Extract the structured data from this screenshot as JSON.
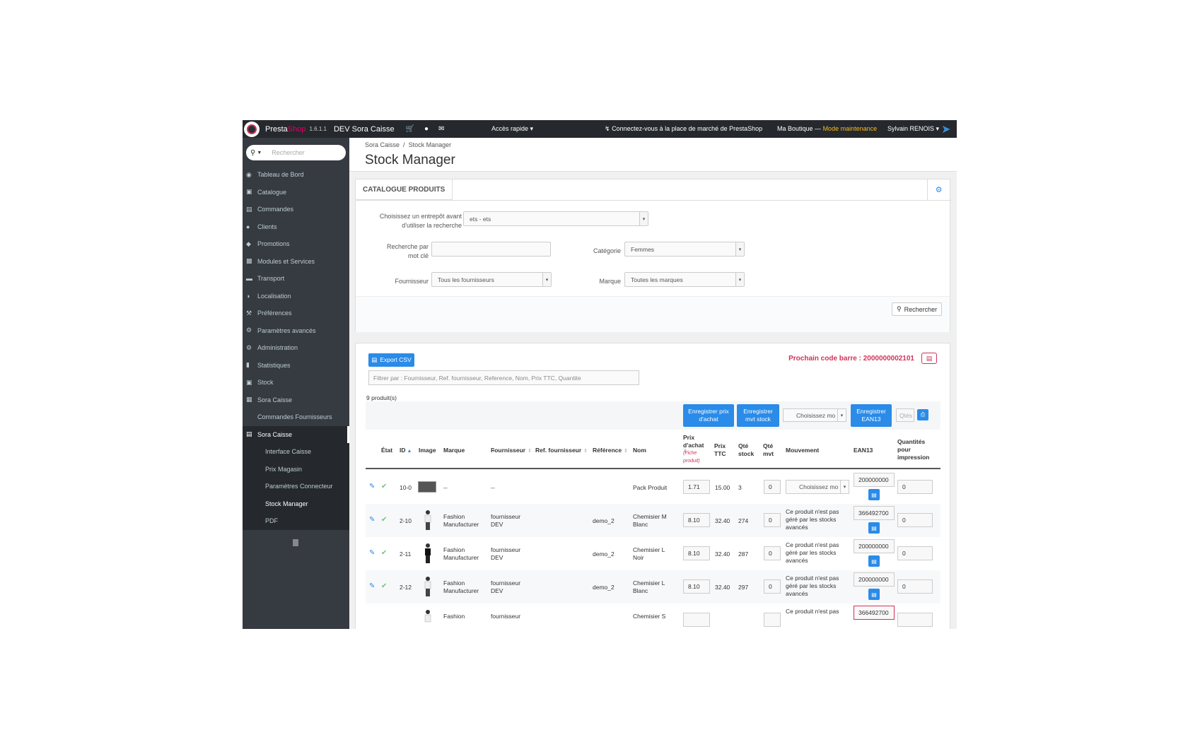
{
  "header": {
    "brand_presta": "Presta",
    "brand_shop": "Shop",
    "version": "1.6.1.1",
    "shop_name": "DEV Sora Caisse",
    "quick_access": "Accès rapide",
    "marketplace": "Connectez-vous à la place de marché de PrestaShop",
    "boutique": "Ma Boutique —",
    "maintenance": "Mode maintenance",
    "user": "Sylvain RENOIS"
  },
  "sidebar": {
    "search_placeholder": "Rechercher",
    "items": [
      {
        "label": "Tableau de Bord",
        "icon": "dashboard-icon"
      },
      {
        "label": "Catalogue",
        "icon": "book-icon"
      },
      {
        "label": "Commandes",
        "icon": "credit-card-icon"
      },
      {
        "label": "Clients",
        "icon": "users-icon"
      },
      {
        "label": "Promotions",
        "icon": "tag-icon"
      },
      {
        "label": "Modules et Services",
        "icon": "puzzle-icon"
      },
      {
        "label": "Transport",
        "icon": "truck-icon"
      },
      {
        "label": "Localisation",
        "icon": "globe-icon"
      },
      {
        "label": "Préférences",
        "icon": "wrench-icon"
      },
      {
        "label": "Paramètres avancés",
        "icon": "gears-icon"
      },
      {
        "label": "Administration",
        "icon": "cog-icon"
      },
      {
        "label": "Statistiques",
        "icon": "bar-chart-icon"
      },
      {
        "label": "Stock",
        "icon": "archive-icon"
      },
      {
        "label": "Sora Caisse",
        "icon": "grid-icon"
      },
      {
        "label": "Commandes Fournisseurs",
        "icon": ""
      },
      {
        "label": "Sora Caisse",
        "icon": "list-icon"
      }
    ],
    "sub_items": [
      "Interface Caisse",
      "Prix Magasin",
      "Paramètres Connecteur",
      "Stock Manager",
      "PDF"
    ]
  },
  "page": {
    "breadcrumb_parent": "Sora Caisse",
    "breadcrumb_sep": "/",
    "breadcrumb_current": "Stock Manager",
    "title": "Stock Manager"
  },
  "search_panel": {
    "tab": "CATALOGUE PRODUITS",
    "warehouse_label_1": "Choisissez un entrepôt avant",
    "warehouse_label_2": "d'utiliser la recherche",
    "warehouse_value": "ets - ets",
    "keyword_label_1": "Recherche par",
    "keyword_label_2": "mot clé",
    "keyword_value": "",
    "category_label": "Catégorie",
    "category_value": "Femmes",
    "supplier_label": "Fournisseur",
    "supplier_value": "Tous les fournisseurs",
    "brand_label": "Marque",
    "brand_value": "Toutes les marques",
    "search_button": "Rechercher"
  },
  "products_panel": {
    "export_csv": "Export CSV",
    "next_barcode": "Prochain code barre : 2000000002101",
    "filter_placeholder": "Filtrer par : Fournisseur, Ref. fournisseur, Reference, Nom, Prix TTC, Quantite",
    "count": "9 produit(s)",
    "btn_save_price_1": "Enregistrer prix",
    "btn_save_price_2": "d'achat",
    "btn_save_mvt_1": "Enregistrer",
    "btn_save_mvt_2": "mvt stock",
    "movement_select": "Choisissez mo",
    "btn_save_ean_1": "Enregistrer",
    "btn_save_ean_2": "EAN13",
    "qty_placeholder": "Qtés"
  },
  "table": {
    "headers": {
      "etat": "État",
      "id": "ID",
      "image": "Image",
      "marque": "Marque",
      "fournisseur": "Fournisseur",
      "ref_fournisseur": "Ref. fournisseur",
      "reference": "Référence",
      "nom": "Nom",
      "prix_achat_1": "Prix",
      "prix_achat_2": "d'achat",
      "fiche_1": "(Fiche",
      "fiche_2": "produit)",
      "prix_ttc_1": "Prix",
      "prix_ttc_2": "TTC",
      "qte_stock_1": "Qté",
      "qte_stock_2": "stock",
      "qte_mvt_1": "Qté",
      "qte_mvt_2": "mvt",
      "mouvement": "Mouvement",
      "ean13": "EAN13",
      "qte_impr_1": "Quantités",
      "qte_impr_2": "pour",
      "qte_impr_3": "impression"
    },
    "rows": [
      {
        "id": "10-0",
        "marque_1": "--",
        "marque_2": "",
        "fournisseur_1": "--",
        "fournisseur_2": "",
        "reference": "",
        "nom_1": "Pack Produit",
        "nom_2": "",
        "prix_achat": "1.71",
        "prix_ttc": "15.00",
        "qte_stock": "3",
        "qte_mvt": "0",
        "mouvement_select": "Choisissez mo",
        "mvt_1": "",
        "mvt_2": "",
        "mvt_3": "",
        "ean13": "200000000",
        "qte_impr": "0"
      },
      {
        "id": "2-10",
        "marque_1": "Fashion",
        "marque_2": "Manufacturer",
        "fournisseur_1": "fournisseur",
        "fournisseur_2": "DEV",
        "reference": "demo_2",
        "nom_1": "Chemisier M",
        "nom_2": "Blanc",
        "prix_achat": "8.10",
        "prix_ttc": "32.40",
        "qte_stock": "274",
        "qte_mvt": "0",
        "mouvement_select": "",
        "mvt_1": "Ce produit n'est pas",
        "mvt_2": "géré par les stocks",
        "mvt_3": "avancés",
        "ean13": "366492700",
        "qte_impr": "0"
      },
      {
        "id": "2-11",
        "marque_1": "Fashion",
        "marque_2": "Manufacturer",
        "fournisseur_1": "fournisseur",
        "fournisseur_2": "DEV",
        "reference": "demo_2",
        "nom_1": "Chemisier L",
        "nom_2": "Noir",
        "prix_achat": "8.10",
        "prix_ttc": "32.40",
        "qte_stock": "287",
        "qte_mvt": "0",
        "mouvement_select": "",
        "mvt_1": "Ce produit n'est pas",
        "mvt_2": "géré par les stocks",
        "mvt_3": "avancés",
        "ean13": "200000000",
        "qte_impr": "0"
      },
      {
        "id": "2-12",
        "marque_1": "Fashion",
        "marque_2": "Manufacturer",
        "fournisseur_1": "fournisseur",
        "fournisseur_2": "DEV",
        "reference": "demo_2",
        "nom_1": "Chemisier L",
        "nom_2": "Blanc",
        "prix_achat": "8.10",
        "prix_ttc": "32.40",
        "qte_stock": "297",
        "qte_mvt": "0",
        "mouvement_select": "",
        "mvt_1": "Ce produit n'est pas",
        "mvt_2": "géré par les stocks",
        "mvt_3": "avancés",
        "ean13": "200000000",
        "qte_impr": "0"
      },
      {
        "id": "",
        "marque_1": "Fashion",
        "marque_2": "",
        "fournisseur_1": "fournisseur",
        "fournisseur_2": "",
        "reference": "",
        "nom_1": "Chemisier S",
        "nom_2": "",
        "prix_achat": "",
        "prix_ttc": "",
        "qte_stock": "",
        "qte_mvt": "",
        "mouvement_select": "",
        "mvt_1": "Ce produit n'est pas",
        "mvt_2": "",
        "mvt_3": "",
        "ean13": "366492700",
        "qte_impr": ""
      }
    ]
  },
  "colors": {
    "accent": "#2a8be8",
    "brand_pink": "#d0335a",
    "sidebar": "#363a41",
    "header": "#25282d",
    "maintenance": "#fbbb22"
  }
}
